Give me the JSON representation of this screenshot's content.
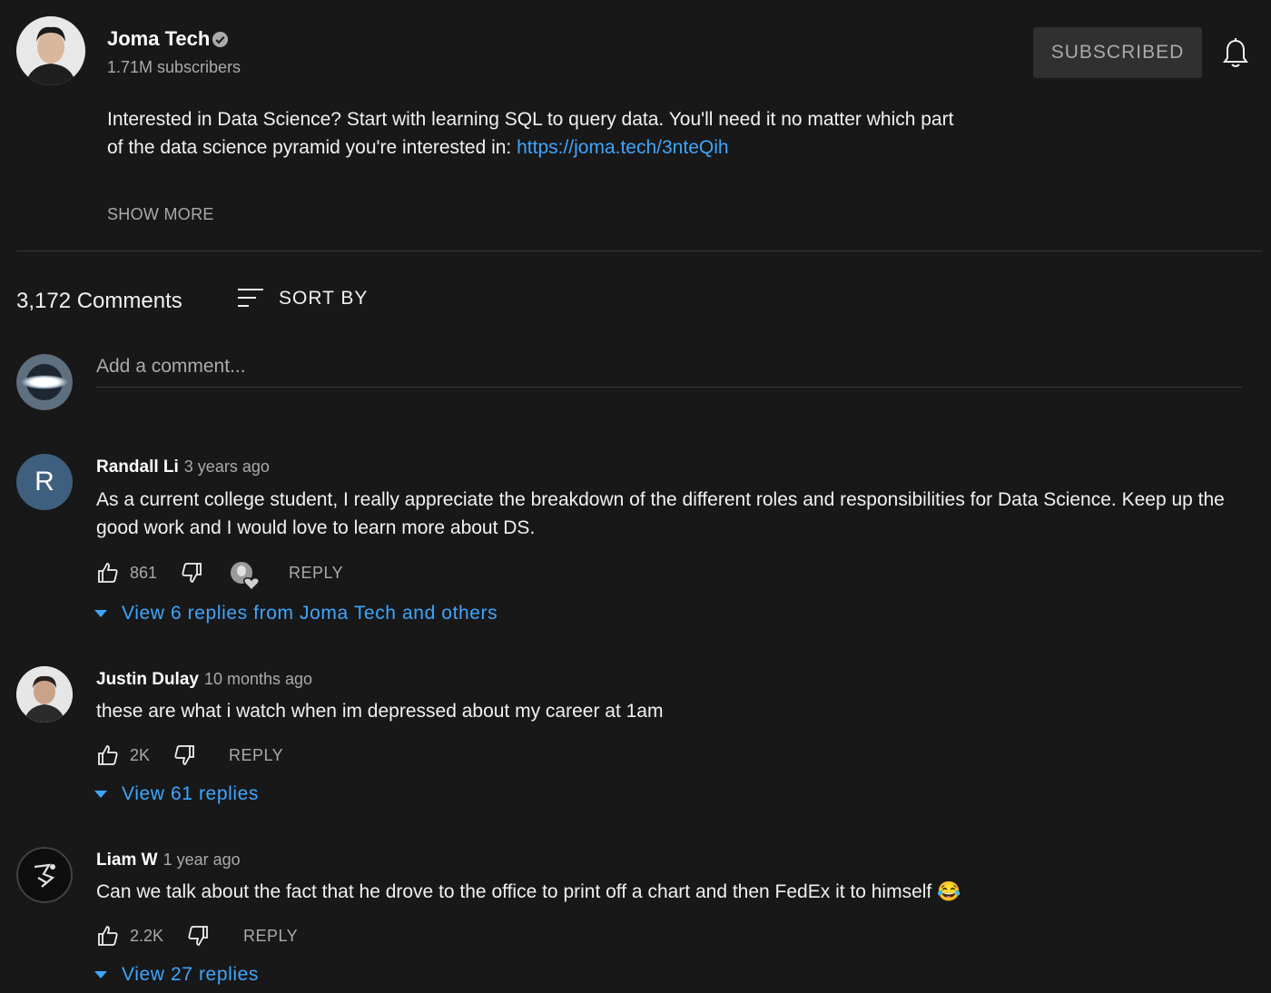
{
  "channel": {
    "name": "Joma Tech",
    "subscribers": "1.71M subscribers",
    "subscribe_label": "SUBSCRIBED",
    "description_text": "Interested in Data Science? Start with learning SQL to query data. You'll need it no matter which part of the data science pyramid you're interested in: ",
    "description_link": "https://joma.tech/3nteQih",
    "show_more": "SHOW MORE"
  },
  "comments_header": {
    "count": "3,172 Comments",
    "sort_label": "SORT BY"
  },
  "add_comment": {
    "placeholder": "Add a comment..."
  },
  "comments": [
    {
      "author": "Randall Li",
      "time": "3 years ago",
      "text": "As a current college student, I really appreciate the breakdown of the different roles and responsibilities for Data Science. Keep up the good work and I would love to learn more about DS.",
      "likes": "861",
      "reply_label": "REPLY",
      "replies_label": "View 6 replies from Joma Tech and others",
      "avatar_letter": "R",
      "avatar_color": "#3f5f7f"
    },
    {
      "author": "Justin Dulay",
      "time": "10 months ago",
      "text": "these are what i watch when im depressed about my career at 1am",
      "likes": "2K",
      "reply_label": "REPLY",
      "replies_label": "View 61 replies"
    },
    {
      "author": "Liam W",
      "time": "1 year ago",
      "text": "Can we talk about the fact that he drove to the office to print off a chart and then FedEx it to himself 😂",
      "likes": "2.2K",
      "reply_label": "REPLY",
      "replies_label": "View 27 replies"
    }
  ],
  "colors": {
    "background": "#181818",
    "link": "#3ea6ff",
    "muted": "#aaaaaa"
  }
}
